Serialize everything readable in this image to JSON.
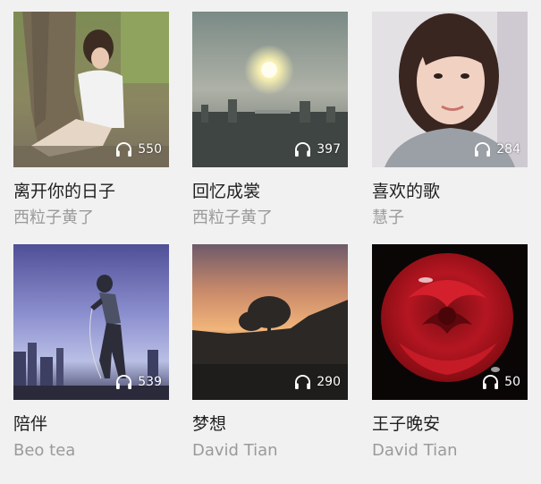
{
  "playlists": [
    {
      "title": "离开你的日子",
      "author": "西粒子黄了",
      "plays": "550",
      "image": "woman-sitting-under-tree"
    },
    {
      "title": "回忆成裳",
      "author": "西粒子黄了",
      "plays": "397",
      "image": "city-skyline-sun"
    },
    {
      "title": "喜欢的歌",
      "author": "慧子",
      "plays": "284",
      "image": "woman-portrait"
    },
    {
      "title": "陪伴",
      "author": "Beo tea",
      "plays": "539",
      "image": "singer-silhouette-city"
    },
    {
      "title": "梦想",
      "author": "David Tian",
      "plays": "290",
      "image": "sunset-tree-silhouette"
    },
    {
      "title": "王子晚安",
      "author": "David Tian",
      "plays": "50",
      "image": "red-rose"
    }
  ],
  "icons": {
    "play_count": "headphones-icon"
  },
  "colors": {
    "background": "#f1f1f1",
    "title": "#1f1f1f",
    "author": "#9a9a9a",
    "overlay_text": "#ffffff"
  }
}
